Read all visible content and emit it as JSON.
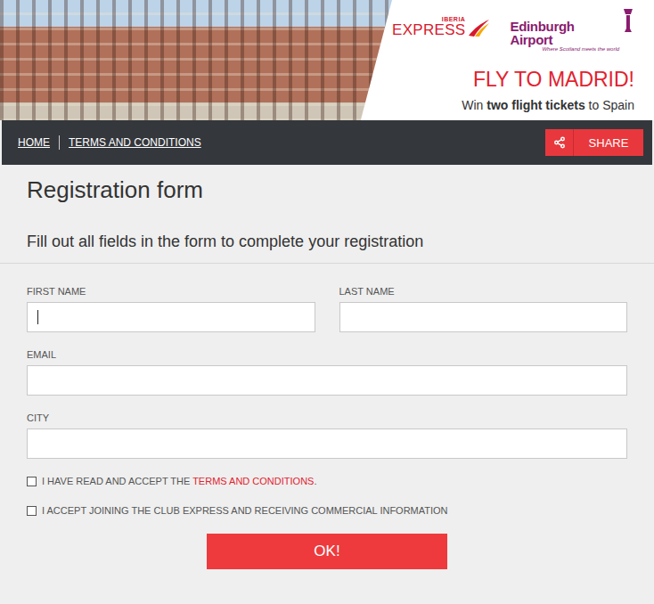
{
  "banner": {
    "airline_logo": {
      "top": "IBERIA",
      "main": "EXPRESS"
    },
    "airport_logo": {
      "name": "Edinburgh Airport",
      "tagline": "Where Scotland meets the world"
    },
    "headline": "FLY TO MADRID!",
    "subline": {
      "before": "Win ",
      "bold": "two flight tickets",
      "after": " to Spain"
    }
  },
  "nav": {
    "links": [
      "HOME",
      "TERMS AND CONDITIONS"
    ],
    "share": "SHARE"
  },
  "form": {
    "title": "Registration form",
    "subtitle": "Fill out all fields in the form to complete your registration",
    "fields": [
      {
        "label": "FIRST NAME",
        "value": "",
        "focused": true,
        "kind": "half"
      },
      {
        "label": "LAST NAME",
        "value": "",
        "focused": false,
        "kind": "half"
      },
      {
        "label": "EMAIL",
        "value": "",
        "focused": false,
        "kind": "full"
      },
      {
        "label": "CITY",
        "value": "",
        "focused": false,
        "kind": "full"
      }
    ],
    "checkboxes": [
      {
        "before": "I HAVE READ AND ACCEPT THE ",
        "link": "TERMS AND CONDITIONS",
        "after": ".",
        "checked": false
      },
      {
        "before": "I ACCEPT JOINING THE CLUB EXPRESS AND RECEIVING COMMERCIAL INFORMATION",
        "link": "",
        "after": "",
        "checked": false
      }
    ],
    "submit": "OK!"
  }
}
